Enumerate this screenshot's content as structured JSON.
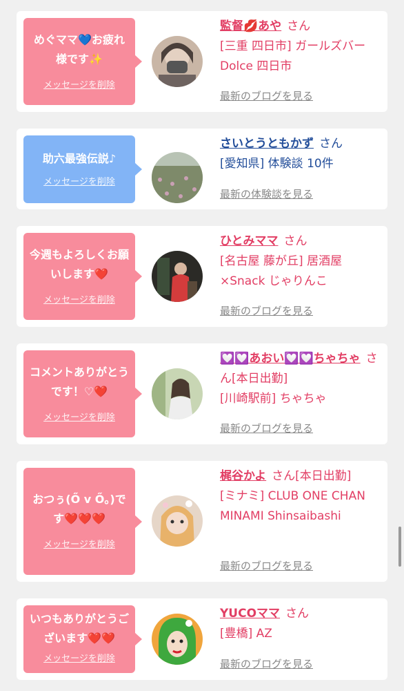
{
  "colors": {
    "pink": "#f88c9c",
    "blue_bubble": "#82b4f6",
    "name_pink": "#e23e64",
    "name_blue": "#234e9a"
  },
  "delete_label": "メッセージを削除",
  "cards": [
    {
      "message": "めぐママ💙お疲れ様です✨",
      "name": "監督💋あや",
      "san": "さん",
      "detail": "[三重 四日市] ガールズバー Dolce 四日市",
      "link": "最新のブログを見る"
    },
    {
      "message": "助六最強伝説♪",
      "name": "さいとうともかず",
      "san": "さん",
      "detail": "[愛知県] 体験談 10件",
      "link": "最新の体験談を見る"
    },
    {
      "message": "今週もよろしくお願いします❤️",
      "name": "ひとみママ",
      "san": "さん",
      "detail": "[名古屋 藤が丘] 居酒屋×Snack じゃりんこ",
      "link": "最新のブログを見る"
    },
    {
      "message": "コメントありがとうです！♡❤️",
      "name": "💟💟あおい💟💟ちゃちゃ",
      "san": "さん[本日出勤]",
      "detail": "[川崎駅前] ちゃちゃ",
      "link": "最新のブログを見る"
    },
    {
      "message": "おつぅ(Ő v Ő。)です❤️❤️❤️",
      "name": "梶谷かよ",
      "san": "さん[本日出勤]",
      "detail": "[ミナミ] CLUB ONE CHAN MINAMI Shinsaibashi",
      "link": "最新のブログを見る"
    },
    {
      "message": "いつもありがとうございます❤️❤️",
      "name": "YUCOママ",
      "san": "さん",
      "detail": "[豊橋] AZ",
      "link": "最新のブログを見る"
    }
  ]
}
